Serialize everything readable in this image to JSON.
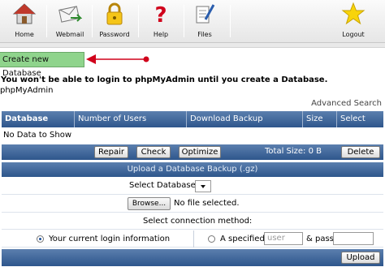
{
  "toolbar": {
    "items": [
      {
        "label": "Home",
        "icon": "home-icon"
      },
      {
        "label": "Webmail",
        "icon": "webmail-icon"
      },
      {
        "label": "Password",
        "icon": "lock-icon"
      },
      {
        "label": "Help",
        "icon": "help-icon"
      },
      {
        "label": "Files",
        "icon": "files-icon"
      },
      {
        "label": "Logout",
        "icon": "star-icon"
      }
    ]
  },
  "create_button": "Create new Database",
  "warning": "You won't be able to login to phpMyAdmin until you create a Database.",
  "phpmyadmin_label": "phpMyAdmin",
  "advanced_search": "Advanced Search",
  "table": {
    "columns": [
      "Database",
      "Number of Users",
      "Download Backup",
      "Size",
      "Select"
    ],
    "empty_text": "No Data to Show"
  },
  "actions": {
    "repair": "Repair",
    "check": "Check",
    "optimize": "Optimize",
    "total_size": "Total Size: 0 B",
    "delete": "Delete"
  },
  "upload": {
    "title": "Upload a Database Backup (.gz)",
    "select_db_label": "Select Database",
    "browse_label": "Browse...",
    "no_file": "No file selected.",
    "connection_label": "Select connection method:",
    "current_login": "Your current login information",
    "specified": "A specified",
    "user_placeholder": "user",
    "and_pass": "& pass",
    "upload_button": "Upload"
  },
  "colors": {
    "header_blue": "#2e568c",
    "create_green": "#8fd48c",
    "arrow_red": "#d0021b"
  }
}
